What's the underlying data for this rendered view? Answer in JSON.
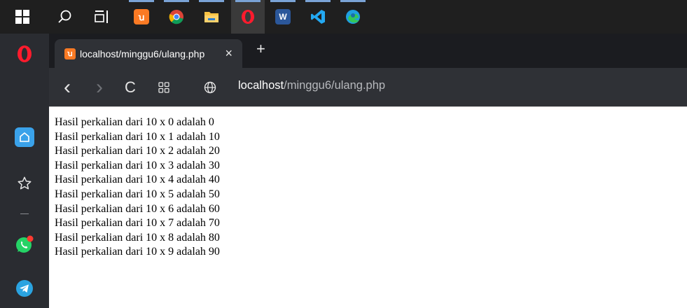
{
  "taskbar": {
    "items": [
      {
        "name": "windows-start-icon"
      },
      {
        "name": "search-icon"
      },
      {
        "name": "task-view-icon"
      },
      {
        "name": "xampp-app-icon",
        "glyph": "ꭒ",
        "color": "#fb7a24"
      },
      {
        "name": "chrome-app-icon"
      },
      {
        "name": "file-explorer-icon"
      },
      {
        "name": "opera-app-icon"
      },
      {
        "name": "word-app-icon",
        "glyph": "W",
        "color": "#2b579a"
      },
      {
        "name": "vscode-app-icon",
        "color": "#23a9f2"
      },
      {
        "name": "edge-app-icon"
      }
    ]
  },
  "sidebar": {
    "items": [
      {
        "name": "opera-logo-icon"
      },
      {
        "name": "home-icon"
      },
      {
        "name": "bookmarks-star-icon"
      },
      {
        "name": "whatsapp-icon"
      },
      {
        "name": "telegram-icon"
      }
    ]
  },
  "tab": {
    "title": "localhost/minggu6/ulang.php",
    "favicon": "xampp-icon",
    "close": "×"
  },
  "new_tab": "+",
  "nav": {
    "back": "‹",
    "forward": "›",
    "reload": "C"
  },
  "address": {
    "host": "localhost",
    "path": "/minggu6/ulang.php"
  },
  "content": {
    "lines": [
      "Hasil perkalian dari 10 x 0 adalah 0",
      "Hasil perkalian dari 10 x 1 adalah 10",
      "Hasil perkalian dari 10 x 2 adalah 20",
      "Hasil perkalian dari 10 x 3 adalah 30",
      "Hasil perkalian dari 10 x 4 adalah 40",
      "Hasil perkalian dari 10 x 5 adalah 50",
      "Hasil perkalian dari 10 x 6 adalah 60",
      "Hasil perkalian dari 10 x 7 adalah 70",
      "Hasil perkalian dari 10 x 8 adalah 80",
      "Hasil perkalian dari 10 x 9 adalah 90"
    ]
  }
}
